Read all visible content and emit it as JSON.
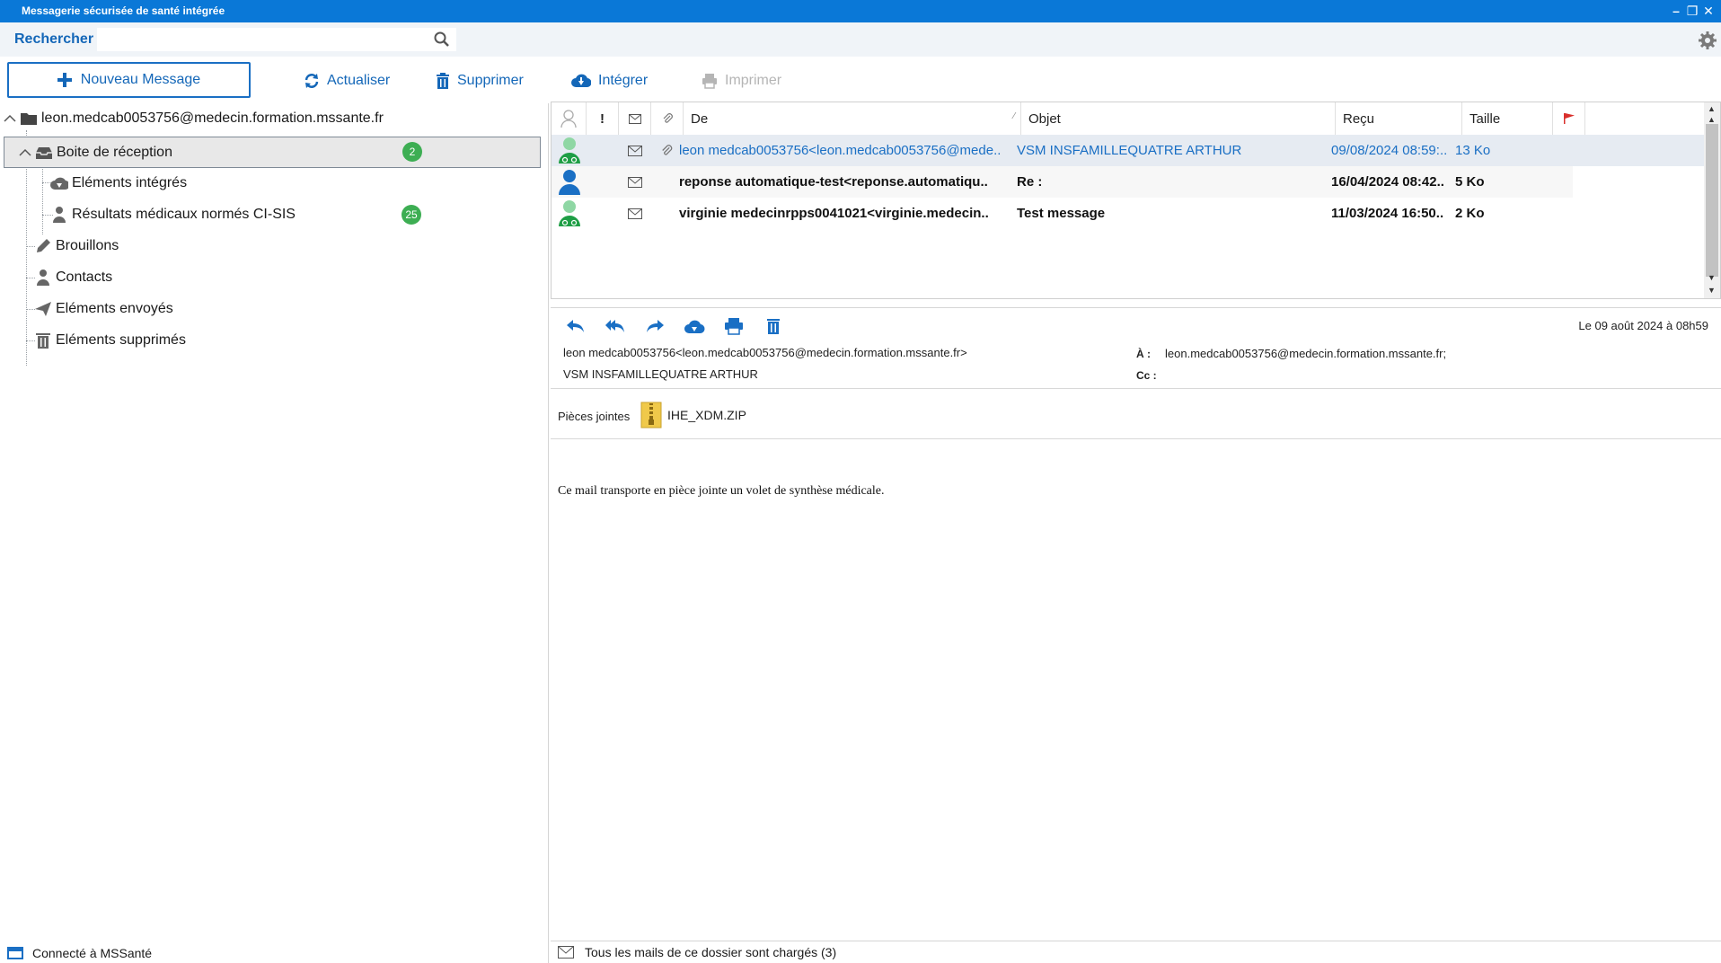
{
  "window": {
    "title": "Messagerie sécurisée de santé intégrée"
  },
  "search": {
    "label": "Rechercher",
    "value": ""
  },
  "toolbar": {
    "new_message": "Nouveau Message",
    "refresh": "Actualiser",
    "delete": "Supprimer",
    "integrate": "Intégrer",
    "print": "Imprimer"
  },
  "folders": {
    "account": "leon.medcab0053756@medecin.formation.mssante.fr",
    "inbox": {
      "label": "Boite de réception",
      "count": "2"
    },
    "integrated": {
      "label": "Eléments intégrés"
    },
    "results": {
      "label": "Résultats médicaux normés CI-SIS",
      "count": "25"
    },
    "drafts": {
      "label": "Brouillons"
    },
    "contacts": {
      "label": "Contacts"
    },
    "sent": {
      "label": "Eléments envoyés"
    },
    "deleted": {
      "label": "Eléments supprimés"
    }
  },
  "status_left": "Connecté à MSSanté",
  "list": {
    "columns": {
      "important": "!",
      "from": "De",
      "subject": "Objet",
      "received": "Reçu",
      "size": "Taille"
    },
    "rows": [
      {
        "from": "leon medcab0053756<leon.medcab0053756@mede..",
        "subject": "VSM INSFAMILLEQUATRE ARTHUR",
        "received": "09/08/2024 08:59:..",
        "size": "13 Ko"
      },
      {
        "from": "reponse automatique-test<reponse.automatiqu..",
        "subject": "Re :",
        "received": "16/04/2024 08:42..",
        "size": "5 Ko"
      },
      {
        "from": "virginie medecinrpps0041021<virginie.medecin..",
        "subject": "Test message",
        "received": "11/03/2024 16:50..",
        "size": "2 Ko"
      }
    ]
  },
  "reading": {
    "date": "Le 09 août 2024 à 08h59",
    "from": "leon medcab0053756<leon.medcab0053756@medecin.formation.mssante.fr>",
    "subject": "VSM INSFAMILLEQUATRE ARTHUR",
    "to_label": "À :",
    "to": "leon.medcab0053756@medecin.formation.mssante.fr;",
    "cc_label": "Cc :",
    "cc": "",
    "attachments_label": "Pièces jointes",
    "attachment": "IHE_XDM.ZIP",
    "body": "Ce mail transporte en pièce jointe un volet de synthèse médicale."
  },
  "status_right": "Tous les mails de ce dossier sont chargés (3)",
  "colors": {
    "accent": "#1467b8",
    "titlebar": "#0a78d7",
    "badge": "#3dae53",
    "flag": "#d9302c",
    "doctor_icon": "#1e9e45"
  }
}
